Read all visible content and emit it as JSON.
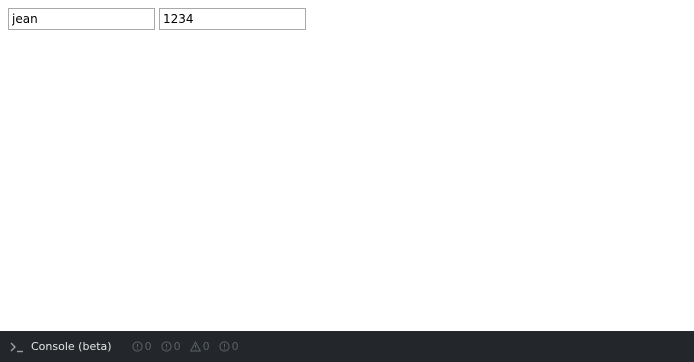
{
  "form": {
    "username_value": "jean",
    "password_value": "1234"
  },
  "console": {
    "label": "Console (beta)",
    "counters": [
      {
        "icon": "info-icon",
        "count": "0"
      },
      {
        "icon": "info-icon",
        "count": "0"
      },
      {
        "icon": "warning-icon",
        "count": "0"
      },
      {
        "icon": "info-icon",
        "count": "0"
      }
    ]
  },
  "colors": {
    "console_bg": "#23272b",
    "console_text": "#e6e6e6",
    "counter_text": "#5b6168",
    "input_border": "#a9a9a9"
  }
}
